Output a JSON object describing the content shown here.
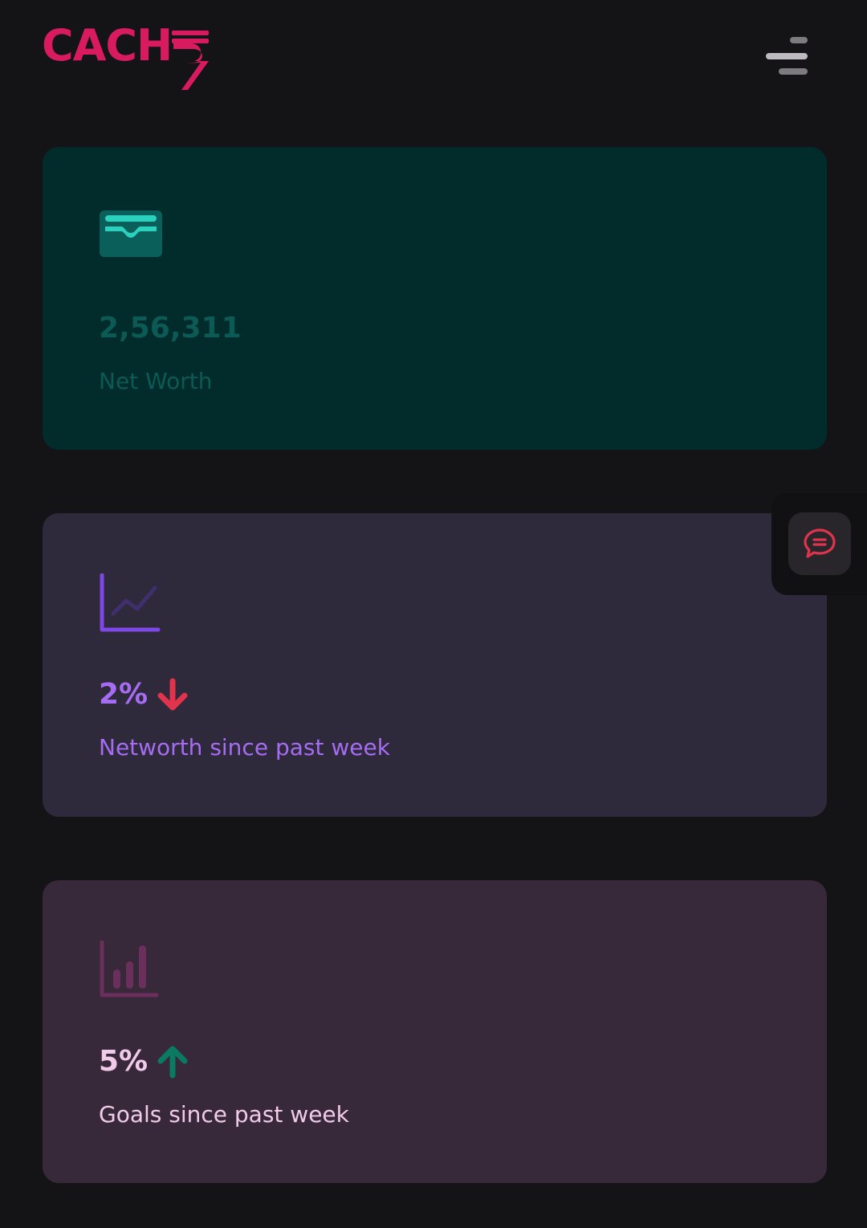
{
  "brand": {
    "logo_text": "CACH",
    "logo_suffix_symbol": "₹",
    "color": "#d81b5e"
  },
  "header": {
    "menu_icon": "hamburger-menu-icon"
  },
  "cards": [
    {
      "icon": "wallet-icon",
      "value": "2,56,311",
      "label": "Net Worth",
      "background": "#022b2b",
      "text_color": "#0b5a55"
    },
    {
      "icon": "line-chart-icon",
      "value": "2%",
      "trend": "down",
      "trend_icon": "arrow-down-icon",
      "trend_color": "#e0344c",
      "label": "Networth since past week",
      "background": "#2e293b",
      "text_color": "#a66cf2"
    },
    {
      "icon": "bar-chart-icon",
      "value": "5%",
      "trend": "up",
      "trend_icon": "arrow-up-icon",
      "trend_color": "#0b7a63",
      "label": "Goals since past week",
      "background": "#37283a",
      "text_color": "#f1cbe9"
    }
  ],
  "chat": {
    "icon": "chat-bubble-icon",
    "color": "#e0344c"
  }
}
